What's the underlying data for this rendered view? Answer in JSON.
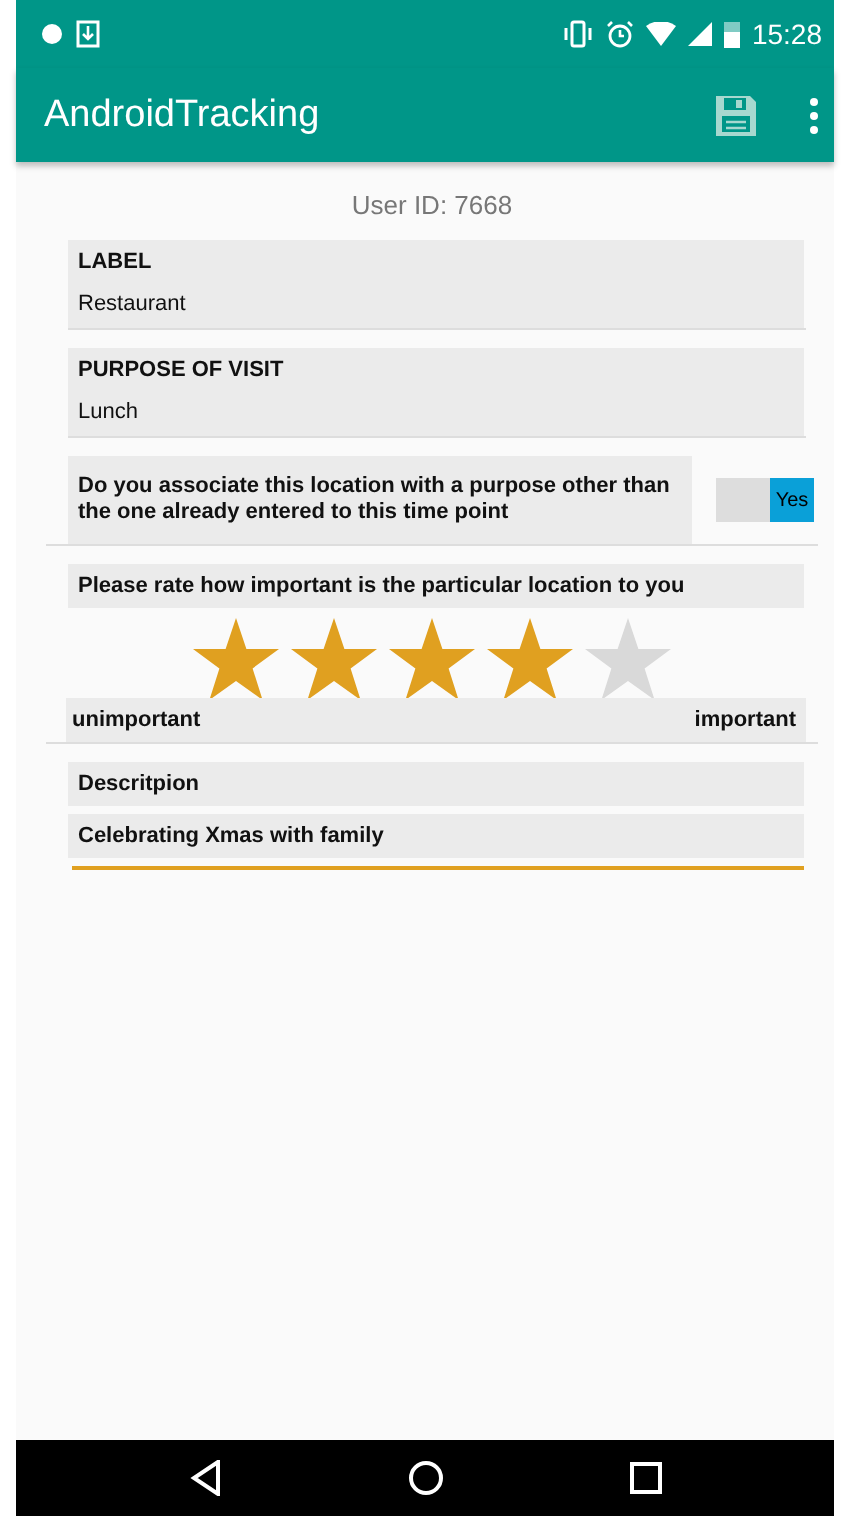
{
  "status_bar": {
    "time": "15:28"
  },
  "app_bar": {
    "title": "AndroidTracking"
  },
  "user_id": "User ID: 7668",
  "fields": [
    {
      "label": "LABEL",
      "value": "Restaurant"
    },
    {
      "label": "PURPOSE OF VISIT",
      "value": "Lunch"
    }
  ],
  "question": {
    "text": "Do you associate this location with a purpose other than the one already entered to this time point",
    "toggle": {
      "on": true,
      "label": "Yes"
    }
  },
  "rating": {
    "prompt": "Please rate how important is the particular location to you",
    "stars": 4,
    "low_label": "unimportant",
    "high_label": "important"
  },
  "description": {
    "label": "Descritpion",
    "value": "Celebrating Xmas with family"
  }
}
